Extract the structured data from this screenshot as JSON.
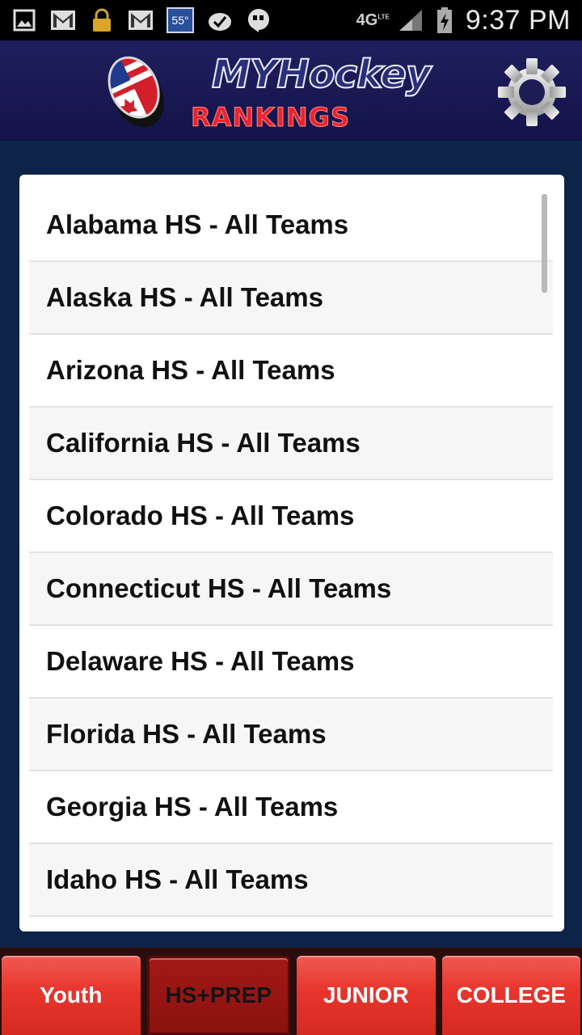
{
  "status_bar": {
    "temperature": "55°",
    "network": "4G",
    "network_sub": "LTE",
    "time": "9:37 PM"
  },
  "header": {
    "logo_title": "MYHockey",
    "logo_subtitle": "RANKINGS",
    "settings_icon": "gear-icon"
  },
  "list": {
    "items": [
      "Alabama HS - All Teams",
      "Alaska HS - All Teams",
      "Arizona HS - All Teams",
      "California HS - All Teams",
      "Colorado HS - All Teams",
      "Connecticut HS - All Teams",
      "Delaware HS - All Teams",
      "Florida HS - All Teams",
      "Georgia HS - All Teams",
      "Idaho HS - All Teams"
    ]
  },
  "tabs": [
    {
      "label": "Youth",
      "active": false
    },
    {
      "label": "HS+PREP",
      "active": true
    },
    {
      "label": "JUNIOR",
      "active": false
    },
    {
      "label": "COLLEGE",
      "active": false
    }
  ],
  "colors": {
    "header_bg": "#1f1f5e",
    "page_bg": "#0d2448",
    "tab_red": "#e7352c",
    "tab_active": "#8a120f"
  }
}
